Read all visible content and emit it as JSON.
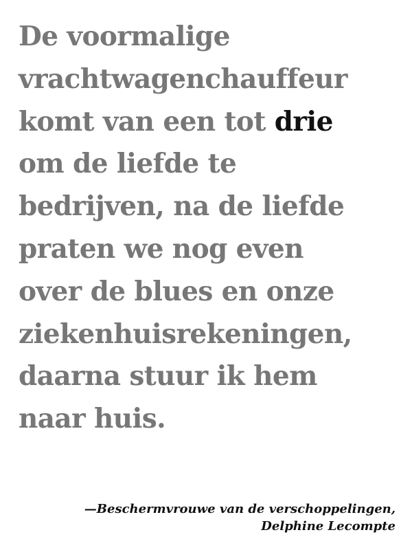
{
  "quote": {
    "lines": [
      "De voormalige",
      "vrachtwagenchauffeur",
      "komt van een tot ",
      "om de liefde te",
      "bedrijven, na de liefde",
      "praten we nog even",
      "over de blues en onze",
      "ziekenhuisrekeningen,",
      "daarna stuur ik hem",
      "naar huis."
    ],
    "highlight": "drie",
    "text_color": "#777777",
    "highlight_color": "#111111"
  },
  "attribution": {
    "line1": "—Beschermvrouwe van de verschoppelingen,",
    "line2": "Delphine Lecompte"
  }
}
